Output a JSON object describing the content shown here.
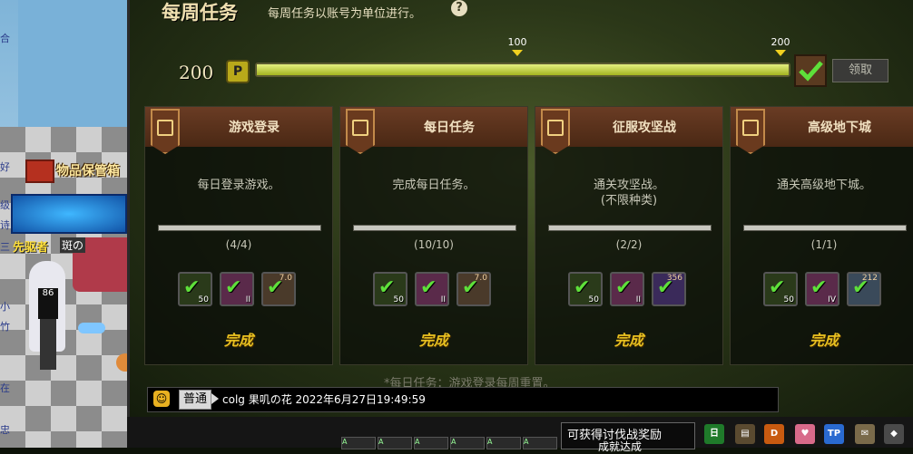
{
  "left_edge": {
    "chars": [
      "合",
      "好",
      "级",
      "诗",
      "三",
      "小",
      "竹",
      "在",
      "忠"
    ]
  },
  "scene": {
    "storage_label": "物品保管箱",
    "char_title": "先驱者",
    "char_name": "斑の",
    "jersey_number": "86"
  },
  "panel": {
    "title": "每周任务",
    "subtitle": "每周任务以账号为单位进行。",
    "help_symbol": "?",
    "points": "200",
    "points_icon": "P",
    "progress_percent": 100,
    "milestone_1": "100",
    "milestone_2": "200",
    "claim_label": "领取"
  },
  "tasks": [
    {
      "title": "游戏登录",
      "desc_1": "每日登录游戏。",
      "desc_2": "",
      "progress": "(4/4)",
      "fill": 100,
      "rewards": [
        {
          "icon": "check-icon",
          "lvl": "50",
          "top": ""
        },
        {
          "icon": "check-icon",
          "lvl": "II",
          "top": ""
        },
        {
          "icon": "check-icon",
          "lvl": "",
          "top": "7.0"
        }
      ],
      "status": "完成"
    },
    {
      "title": "每日任务",
      "desc_1": "完成每日任务。",
      "desc_2": "",
      "progress": "(10/10)",
      "fill": 100,
      "rewards": [
        {
          "icon": "check-icon",
          "lvl": "50",
          "top": ""
        },
        {
          "icon": "check-icon",
          "lvl": "II",
          "top": ""
        },
        {
          "icon": "check-icon",
          "lvl": "",
          "top": "7.0"
        }
      ],
      "status": "完成"
    },
    {
      "title": "征服攻坚战",
      "desc_1": "通关攻坚战。",
      "desc_2": "(不限种类)",
      "progress": "(2/2)",
      "fill": 100,
      "rewards": [
        {
          "icon": "check-icon",
          "lvl": "50",
          "top": ""
        },
        {
          "icon": "check-icon",
          "lvl": "II",
          "top": ""
        },
        {
          "icon": "check-icon",
          "lvl": "",
          "top": "356"
        }
      ],
      "status": "完成"
    },
    {
      "title": "高级地下城",
      "desc_1": "通关高级地下城。",
      "desc_2": "",
      "progress": "(1/1)",
      "fill": 100,
      "rewards": [
        {
          "icon": "check-icon",
          "lvl": "50",
          "top": ""
        },
        {
          "icon": "check-icon",
          "lvl": "IV",
          "top": ""
        },
        {
          "icon": "check-icon",
          "lvl": "",
          "top": "212"
        }
      ],
      "status": "完成"
    }
  ],
  "hint": "*每日任务：游戏登录每周重置。",
  "chat": {
    "emoji": "☺",
    "channel": "普通",
    "message": "colg 果叽の花 2022年6月27日19:49:59"
  },
  "taskbar": {
    "slot_label": "A",
    "reward_tip_1": "可获得讨伐战奖励",
    "reward_tip_2": "成就达成",
    "icons": [
      "日",
      "▤",
      "D",
      "♥",
      "TP",
      "✉",
      "◆"
    ]
  },
  "colors": {
    "accent": "#e8c020",
    "check": "#5ee03a",
    "brown_header": "#6a3c24"
  }
}
